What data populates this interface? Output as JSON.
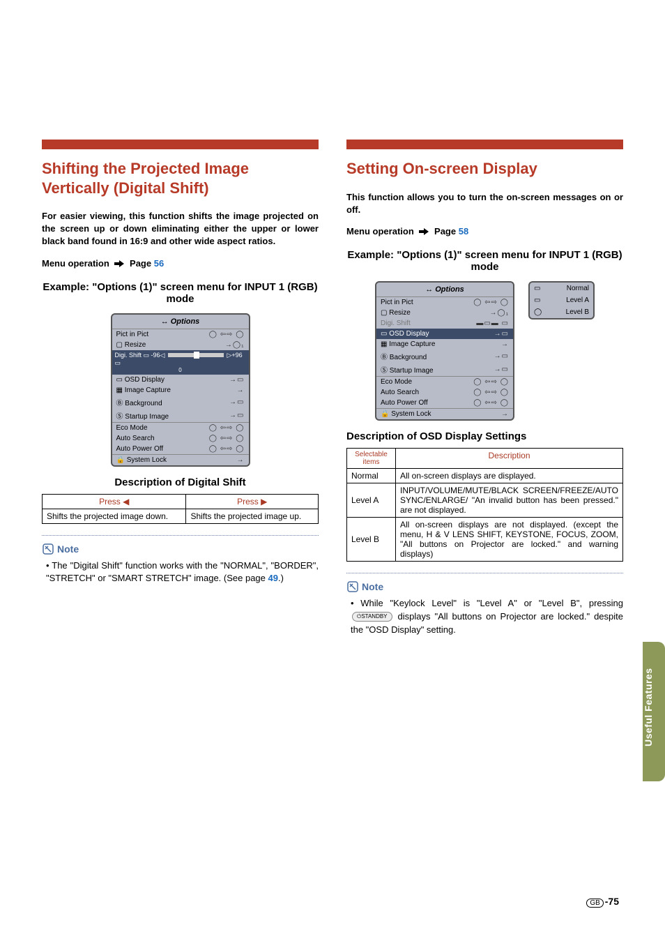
{
  "left": {
    "title": "Shifting the Projected Image Vertically (Digital Shift)",
    "intro": "For easier viewing, this function shifts the image projected on the screen up or down eliminating either the upper or lower black band found in 16:9 and other wide aspect ratios.",
    "menuop_prefix": "Menu operation",
    "menuop_page_label": "Page",
    "menuop_page": "56",
    "example_heading": "Example: \"Options (1)\" screen menu for INPUT 1 (RGB) mode",
    "osd": {
      "title": "Options",
      "items": {
        "pict_in_pict": "Pict in Pict",
        "resize": "Resize",
        "digi_shift": "Digi. Shift",
        "digi_slider_min": "-96",
        "digi_slider_val": "0",
        "digi_slider_max": "+96",
        "osd_display": "OSD Display",
        "image_capture": "Image Capture",
        "background": "Background",
        "startup_image": "Startup Image",
        "eco_mode": "Eco Mode",
        "auto_search": "Auto Search",
        "auto_power_off": "Auto Power Off",
        "system_lock": "System Lock"
      }
    },
    "desc_heading": "Description of Digital Shift",
    "table": {
      "h1": "Press ◀",
      "h2": "Press ▶",
      "c1": "Shifts the projected image down.",
      "c2": "Shifts the projected image up."
    },
    "note_label": "Note",
    "note_body_1": "The \"Digital Shift\" function works with the \"NORMAL\", \"BORDER\", \"STRETCH\" or \"SMART STRETCH\" image. (See page ",
    "note_page": "49",
    "note_body_2": ".)"
  },
  "right": {
    "title": "Setting On-screen Display",
    "intro": "This function allows you to turn the on-screen messages on or off.",
    "menuop_prefix": "Menu operation",
    "menuop_page_label": "Page",
    "menuop_page": "58",
    "example_heading": "Example: \"Options (1)\" screen menu for INPUT 1 (RGB) mode",
    "osd": {
      "title": "Options",
      "items": {
        "pict_in_pict": "Pict in Pict",
        "resize": "Resize",
        "digi_shift": "Digi. Shift",
        "osd_display": "OSD Display",
        "image_capture": "Image Capture",
        "background": "Background",
        "startup_image": "Startup Image",
        "eco_mode": "Eco Mode",
        "auto_search": "Auto Search",
        "auto_power_off": "Auto Power Off",
        "system_lock": "System Lock"
      }
    },
    "submenu": {
      "normal": "Normal",
      "level_a": "Level A",
      "level_b": "Level B"
    },
    "desc_heading": "Description of OSD Display Settings",
    "table": {
      "h_sel": "Selectable items",
      "h_desc": "Description",
      "r1_sel": "Normal",
      "r1_desc": "All on-screen displays are displayed.",
      "r2_sel": "Level A",
      "r2_desc": "INPUT/VOLUME/MUTE/BLACK SCREEN/FREEZE/AUTO SYNC/ENLARGE/ \"An invalid button has been pressed.\" are not displayed.",
      "r3_sel": "Level B",
      "r3_desc": "All on-screen displays are not displayed. (except the menu, H & V LENS SHIFT, KEYSTONE, FOCUS, ZOOM, \"All buttons on Projector are locked.\" and warning displays)"
    },
    "note_label": "Note",
    "note_body_1": "While \"Keylock Level\" is \"Level A\" or \"Level B\", pressing ",
    "note_standby": "STANDBY",
    "note_body_2": " displays \"All buttons on Projector are locked.\" despite the \"OSD Display\" setting."
  },
  "sidetab": "Useful Features",
  "footer": {
    "region": "GB",
    "page": "-75"
  }
}
